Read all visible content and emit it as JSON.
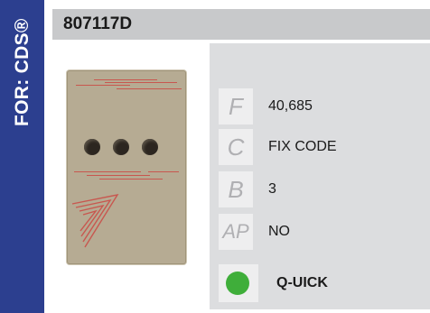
{
  "sidebar": {
    "text": "FOR: CDS®"
  },
  "header": {
    "title": "807117D"
  },
  "specs": [
    {
      "letter": "F",
      "value": "40,685"
    },
    {
      "letter": "C",
      "value": "FIX CODE"
    },
    {
      "letter": "B",
      "value": "3"
    },
    {
      "letter": "AP",
      "value": "NO"
    }
  ],
  "feature": {
    "label": "Q-UICK",
    "color": "#3fae3a"
  },
  "remote_colors": {
    "body": "#b6ab93",
    "stripe": "#c8574f",
    "button": "#2c2620"
  }
}
